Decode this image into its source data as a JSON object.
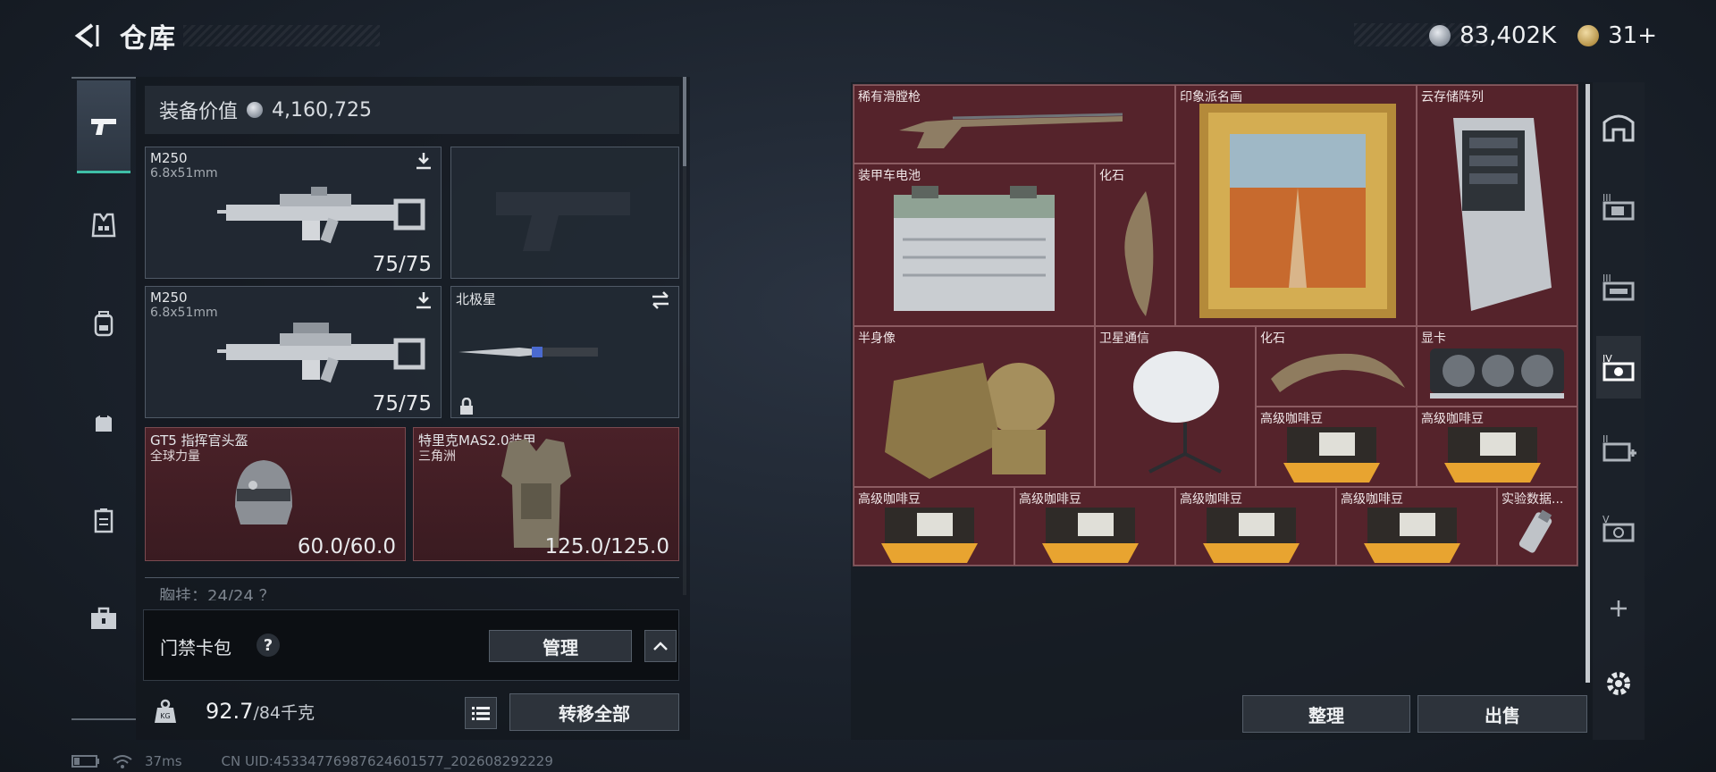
{
  "header": {
    "title": "仓库",
    "currency_silver": "83,402K",
    "currency_gold": "31+"
  },
  "loadout": {
    "value_label": "装备价值",
    "value": "4,160,725",
    "primary_1": {
      "name": "M250",
      "caliber": "6.8x51mm",
      "ammo": "75/75"
    },
    "primary_2": {
      "name": "M250",
      "caliber": "6.8x51mm",
      "ammo": "75/75"
    },
    "melee": {
      "name": "北极星"
    },
    "helmet": {
      "name": "GT5 指挥官头盔",
      "sub": "全球力量",
      "durability": "60.0/60.0"
    },
    "armor": {
      "name": "特里克MAS2.0装甲",
      "sub": "三角洲",
      "durability": "125.0/125.0"
    },
    "chest_rig": "胸挂：24/24 ？",
    "keycard_label": "门禁卡包",
    "keycard_help": "?",
    "manage_label": "管理",
    "weight": "92.7",
    "weight_capacity": "/84千克",
    "transfer_all_label": "转移全部"
  },
  "storage": {
    "items": [
      {
        "label": "稀有滑膛枪"
      },
      {
        "label": "印象派名画"
      },
      {
        "label": "云存储阵列"
      },
      {
        "label": "装甲车电池"
      },
      {
        "label": "化石"
      },
      {
        "label": "半身像"
      },
      {
        "label": "卫星通信"
      },
      {
        "label": "化石"
      },
      {
        "label": "显卡"
      },
      {
        "label": "高级咖啡豆"
      },
      {
        "label": "高级咖啡豆"
      },
      {
        "label": "高级咖啡豆"
      },
      {
        "label": "高级咖啡豆"
      },
      {
        "label": "高级咖啡豆"
      },
      {
        "label": "高级咖啡豆"
      },
      {
        "label": "实验数据..."
      }
    ],
    "sort_label": "整理",
    "sell_label": "出售"
  },
  "right_tabs": [
    "home-tab-icon",
    "storage-III-a-icon",
    "storage-III-b-icon",
    "storage-IV-icon",
    "storage-II-icon",
    "storage-V-icon",
    "add-icon",
    "settings-icon"
  ],
  "status": {
    "ping": "37ms",
    "uid": "CN UID:45334776987624601577_202608292229"
  },
  "colors": {
    "accent": "#3fbfa7",
    "item_bg": "#55232b",
    "item_border": "#8c5c62"
  }
}
